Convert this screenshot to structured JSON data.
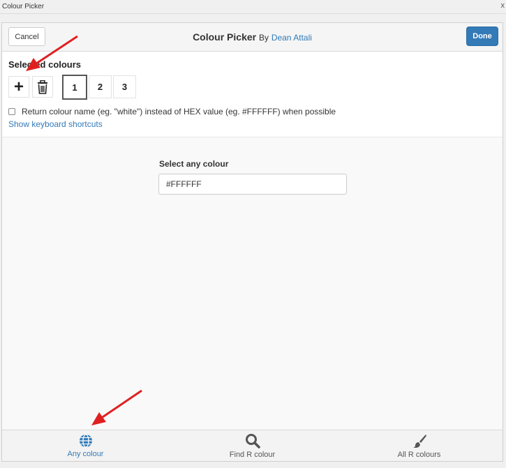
{
  "window": {
    "title": "Colour Picker",
    "close_glyph": "x"
  },
  "header": {
    "cancel_label": "Cancel",
    "title": "Colour Picker",
    "by_text": "By",
    "author": "Dean Attali",
    "done_label": "Done"
  },
  "selected": {
    "label": "Selected colours",
    "add_symbol": "+",
    "swatches": [
      "1",
      "2",
      "3"
    ],
    "active_index": 0
  },
  "options": {
    "return_name_label": "Return colour name (eg. \"white\") instead of HEX value (eg. #FFFFFF) when possible",
    "return_name_checked": false,
    "shortcuts_link": "Show keyboard shortcuts"
  },
  "main": {
    "select_label": "Select any colour",
    "hex_value": "#FFFFFF"
  },
  "tabs": [
    {
      "label": "Any colour",
      "icon": "globe-icon",
      "active": true
    },
    {
      "label": "Find R colour",
      "icon": "search-icon",
      "active": false
    },
    {
      "label": "All R colours",
      "icon": "paintbrush-icon",
      "active": false
    }
  ],
  "colors": {
    "accent": "#337ab7",
    "annotation_arrow": "#e02020"
  }
}
